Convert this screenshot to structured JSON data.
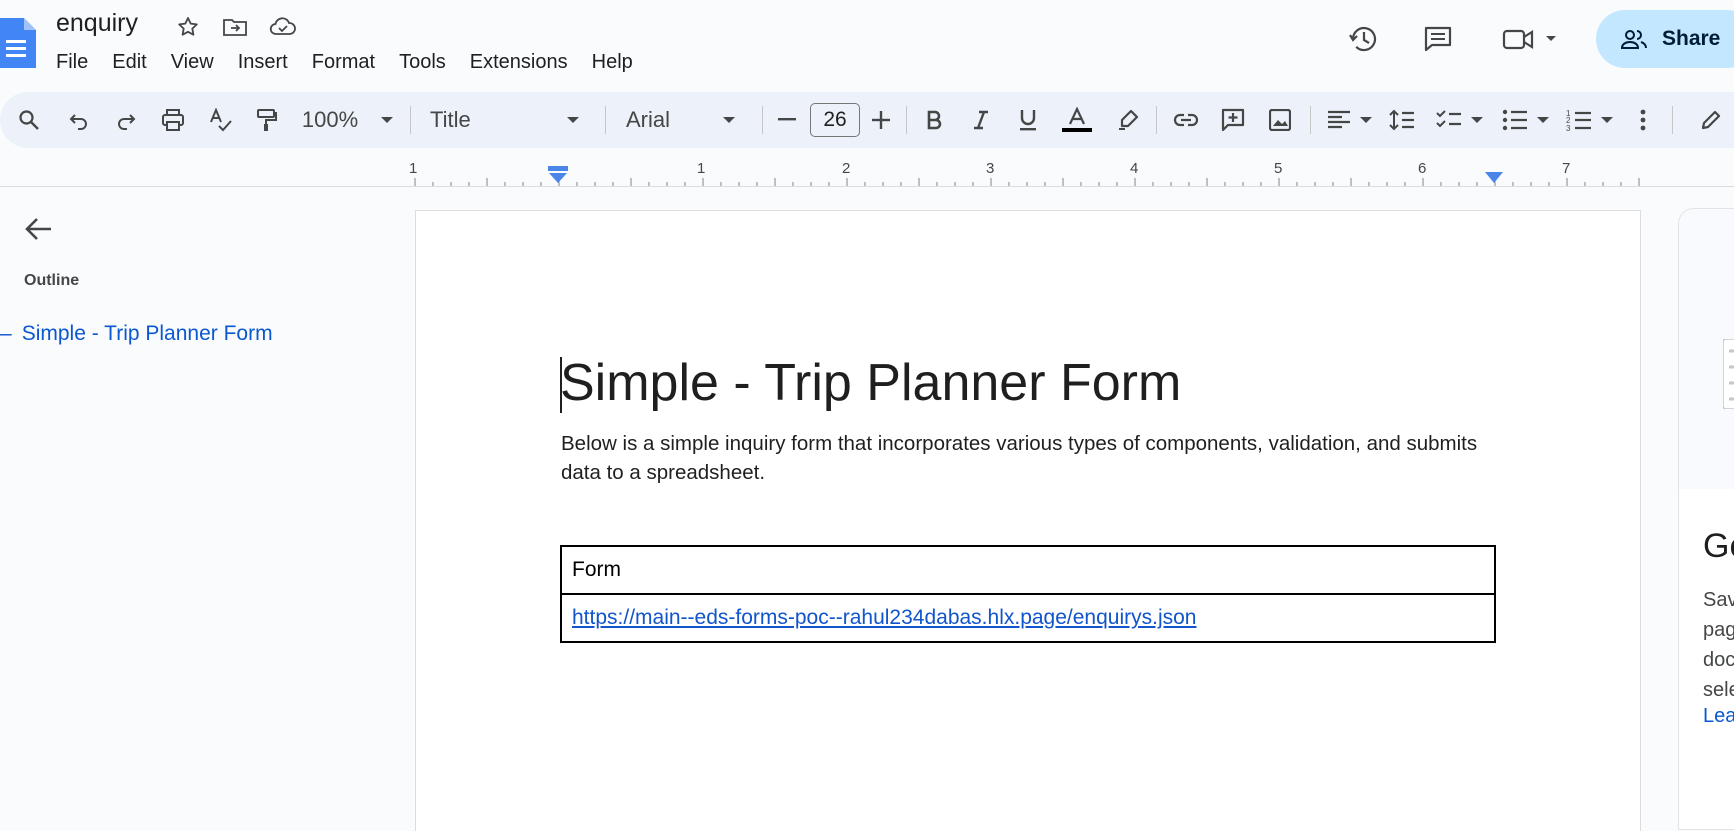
{
  "document": {
    "title": "enquiry"
  },
  "menu": [
    "File",
    "Edit",
    "View",
    "Insert",
    "Format",
    "Tools",
    "Extensions",
    "Help"
  ],
  "share": {
    "label": "Share"
  },
  "toolbar": {
    "zoom": "100%",
    "style": "Title",
    "font": "Arial",
    "font_size": "26"
  },
  "ruler": {
    "labels": [
      "1",
      "1",
      "2",
      "3",
      "4",
      "5",
      "6",
      "7"
    ]
  },
  "outline": {
    "heading": "Outline",
    "items": [
      {
        "label": "Simple - Trip Planner Form"
      }
    ]
  },
  "page": {
    "heading": "Simple - Trip Planner Form",
    "paragraph": "Below is a simple inquiry form that incorporates various types of components, validation, and submits data to a spreadsheet.",
    "table": {
      "header": "Form",
      "link": "https://main--eds-forms-poc--rahul234dabas.hlx.page/enquirys.json"
    }
  },
  "side_panel": {
    "heading": "Ge",
    "body_lines": [
      "Sav",
      "pag",
      "doc",
      "sele"
    ],
    "link": "Lea"
  },
  "colors": {
    "accent_blue": "#0b57d0",
    "share_bg": "#c2e7ff",
    "toolbar_bg": "#edf2fa",
    "page_bg": "#f9fbfd"
  }
}
